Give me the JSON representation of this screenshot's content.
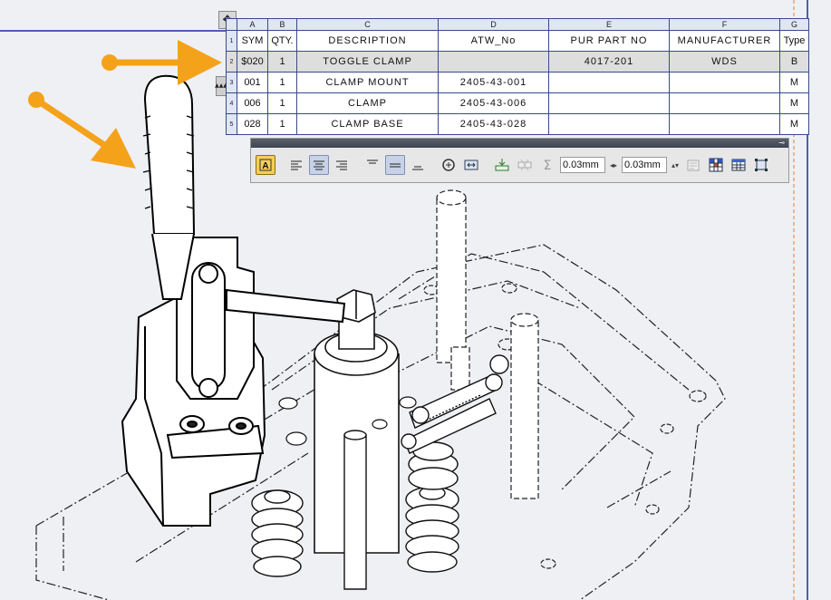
{
  "table": {
    "col_letters": [
      "A",
      "B",
      "C",
      "D",
      "E",
      "F",
      "G"
    ],
    "headers": [
      "SYM",
      "QTY.",
      "DESCRIPTION",
      "ATW_No",
      "PUR PART NO",
      "MANUFACTURER",
      "Type"
    ],
    "row_numbers": [
      "1",
      "2",
      "3",
      "4",
      "5"
    ],
    "rows": [
      [
        "$020",
        "1",
        "TOGGLE CLAMP",
        "",
        "4017-201",
        "WDS",
        "B"
      ],
      [
        "001",
        "1",
        "CLAMP MOUNT",
        "2405-43-001",
        "",
        "",
        "M"
      ],
      [
        "006",
        "1",
        "CLAMP",
        "2405-43-006",
        "",
        "",
        "M"
      ],
      [
        "028",
        "1",
        "CLAMP BASE",
        "2405-43-028",
        "",
        "",
        "M"
      ]
    ],
    "selected_row_index": 0
  },
  "toolbar": {
    "buttons": [
      "text-frame-icon",
      "align-left-icon",
      "align-center-icon",
      "align-right-icon",
      "valign-top-icon",
      "valign-middle-icon",
      "valign-bottom-icon",
      "transpose-icon",
      "fit-columns-icon",
      "insert-row-icon",
      "delete-row-icon",
      "sigma-icon"
    ],
    "margin_h": "0.03mm",
    "margin_v": "0.03mm",
    "trailing_buttons": [
      "properties-icon",
      "grid-colored-icon",
      "table-icon",
      "fit-frame-icon"
    ]
  },
  "annotations": {
    "arrow_color": "#f5a21b"
  },
  "colors": {
    "table_border": "#3a4a8a",
    "header_bg": "#dfe6f5",
    "selected_row": "#dedede",
    "frame_line": "#1e2a9e",
    "guide_line": "#ef7a2f"
  }
}
